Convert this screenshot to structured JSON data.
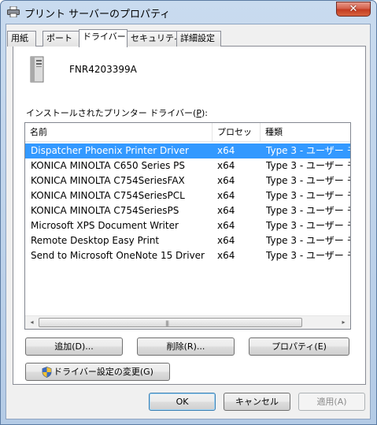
{
  "window": {
    "title": "プリント サーバーのプロパティ",
    "close_label": "✕"
  },
  "tabs": [
    {
      "label": "用紙"
    },
    {
      "label": "ポート"
    },
    {
      "label": "ドライバー"
    },
    {
      "label": "セキュリティ"
    },
    {
      "label": "詳細設定"
    }
  ],
  "active_tab": "ドライバー",
  "server": {
    "name": "FNR4203399A"
  },
  "drivers_section": {
    "label_prefix": "インストールされたプリンター ドライバー(",
    "label_key": "P",
    "label_suffix": "):"
  },
  "drivers_table": {
    "columns": [
      "名前",
      "プロセッサ",
      "種類"
    ],
    "rows": [
      {
        "name": "Dispatcher Phoenix Printer Driver",
        "processor": "x64",
        "type": "Type 3 - ユーザー モ",
        "selected": true
      },
      {
        "name": "KONICA MINOLTA C650 Series PS",
        "processor": "x64",
        "type": "Type 3 - ユーザー モ",
        "selected": false
      },
      {
        "name": "KONICA MINOLTA C754SeriesFAX",
        "processor": "x64",
        "type": "Type 3 - ユーザー モ",
        "selected": false
      },
      {
        "name": "KONICA MINOLTA C754SeriesPCL",
        "processor": "x64",
        "type": "Type 3 - ユーザー モ",
        "selected": false
      },
      {
        "name": "KONICA MINOLTA C754SeriesPS",
        "processor": "x64",
        "type": "Type 3 - ユーザー モ",
        "selected": false
      },
      {
        "name": "Microsoft XPS Document Writer",
        "processor": "x64",
        "type": "Type 3 - ユーザー モ",
        "selected": false
      },
      {
        "name": "Remote Desktop Easy Print",
        "processor": "x64",
        "type": "Type 3 - ユーザー モ",
        "selected": false
      },
      {
        "name": "Send to Microsoft OneNote 15 Driver",
        "processor": "x64",
        "type": "Type 3 - ユーザー モ",
        "selected": false
      }
    ],
    "scroll_left": "◂",
    "scroll_right": "▸",
    "scroll_grip": "|||"
  },
  "buttons": {
    "add": "追加(D)...",
    "remove": "削除(R)...",
    "properties": "プロパティ(E)",
    "change_driver_settings": "ドライバー設定の変更(G)",
    "ok": "OK",
    "cancel": "キャンセル",
    "apply": "適用(A)"
  },
  "colors": {
    "selection": "#3399ff",
    "window_frame": "#b9d1ea",
    "close_button": "#c43c21"
  }
}
